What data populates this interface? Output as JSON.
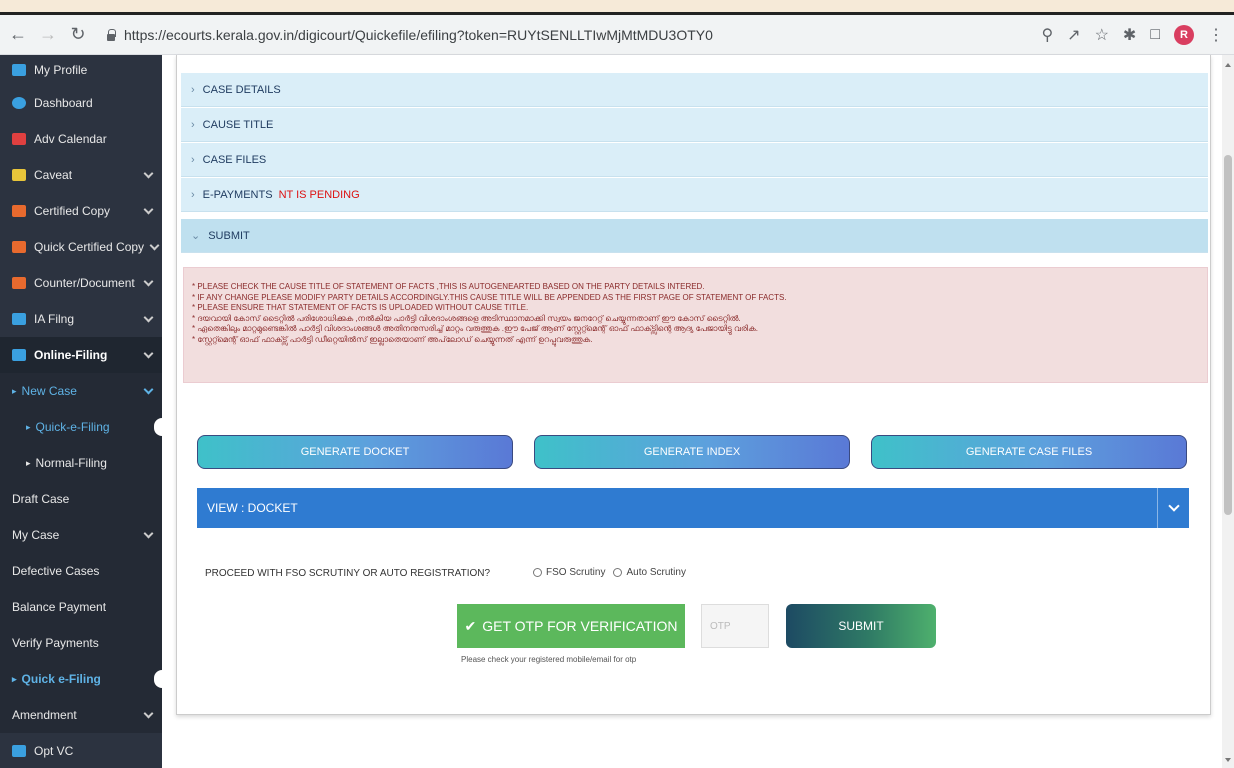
{
  "browser": {
    "url": "https://ecourts.kerala.gov.in/digicourt/Quickefile/efiling?token=RUYtSENLLTIwMjMtMDU3OTY0",
    "profile_initial": "R"
  },
  "sidebar": {
    "items": [
      {
        "label": "My Profile",
        "icon_color": "#3aa0e0"
      },
      {
        "label": "Dashboard",
        "icon_color": "#3aa0e0"
      },
      {
        "label": "Adv Calendar",
        "icon_color": "#e04040"
      },
      {
        "label": "Caveat",
        "icon_color": "#e8c53a"
      },
      {
        "label": "Certified Copy",
        "icon_color": "#e86a2e"
      },
      {
        "label": "Quick Certified Copy",
        "icon_color": "#e86a2e"
      },
      {
        "label": "Counter/Document",
        "icon_color": "#e86a2e"
      },
      {
        "label": "IA Filng",
        "icon_color": "#3aa0e0"
      },
      {
        "label": "Online-Filing",
        "icon_color": "#3aa0e0"
      },
      {
        "label": "New Case"
      },
      {
        "label": "Quick-e-Filing"
      },
      {
        "label": "Normal-Filing"
      },
      {
        "label": "Draft Case"
      },
      {
        "label": "My Case"
      },
      {
        "label": "Defective Cases"
      },
      {
        "label": "Balance Payment"
      },
      {
        "label": "Verify Payments"
      },
      {
        "label": "Quick e-Filing"
      },
      {
        "label": "Amendment"
      },
      {
        "label": "Opt VC",
        "icon_color": "#3aa0e0"
      }
    ]
  },
  "accordion": {
    "case_details": "CASE DETAILS",
    "cause_title": "CAUSE TITLE",
    "case_files": "CASE FILES",
    "e_payments": "E-PAYMENTS",
    "e_payments_warning": "NT IS PENDING",
    "submit": "SUBMIT"
  },
  "notice": {
    "lines": [
      "* PLEASE CHECK THE CAUSE TITLE OF STATEMENT OF FACTS ,THIS IS AUTOGENEARTED BASED ON THE PARTY DETAILS INTERED.",
      "* IF ANY CHANGE PLEASE MODIFY PARTY DETAILS ACCORDINGLY.THIS CAUSE TITLE WILL BE APPENDED AS THE FIRST PAGE OF STATEMENT OF FACTS.",
      "* PLEASE ENSURE THAT STATEMENT OF FACTS IS UPLOADED WITHOUT CAUSE TITLE.",
      "* ദയവായി കോസ് ടൈറ്റിൽ പരിശോധിക്കുക ,നൽകിയ പാർട്ടി വിശദാംശങ്ങളെ അടിസ്ഥാനമാക്കി സ്വയം ജനറേറ്റ് ചെയ്യുന്നതാണ് ഈ കോസ് ടൈറ്റിൽ.",
      "* ഏതെങ്കിലും മാറ്റമുണ്ടെങ്കിൽ പാർട്ടി വിശദാംശങ്ങൾ അതിനനുസരിച്ച് മാറ്റം വരുത്തുക .ഈ പേജ് ആണ് സ്റ്റേറ്റ്മെന്റ് ഓഫ് ഫാക്ട്സിന്റെ ആദ്യ പേജായിട്ടു വരിക.",
      "* സ്റ്റേറ്റ്മെന്റ് ഓഫ് ഫാക്ട്സ് പാർട്ടി ഡീറ്റെയിൽസ് ഇല്ലാതെയാണ് അപ്‌ലോഡ് ചെയ്യുന്നത് എന്ന് ഉറപ്പുവരുത്തുക."
    ]
  },
  "buttons": {
    "generate_docket": "GENERATE DOCKET",
    "generate_index": "GENERATE INDEX",
    "generate_case_files": "GENERATE CASE FILES"
  },
  "view_bar": {
    "label": "VIEW : DOCKET"
  },
  "verification": {
    "question": "PROCEED WITH FSO SCRUTINY OR AUTO REGISTRATION?",
    "option_fso": "FSO Scrutiny",
    "option_auto": "Auto Scrutiny",
    "otp_button": "GET OTP FOR VERIFICATION",
    "otp_placeholder": "OTP",
    "submit_button": "SUBMIT",
    "hint": "Please check your registered mobile/email for otp"
  }
}
